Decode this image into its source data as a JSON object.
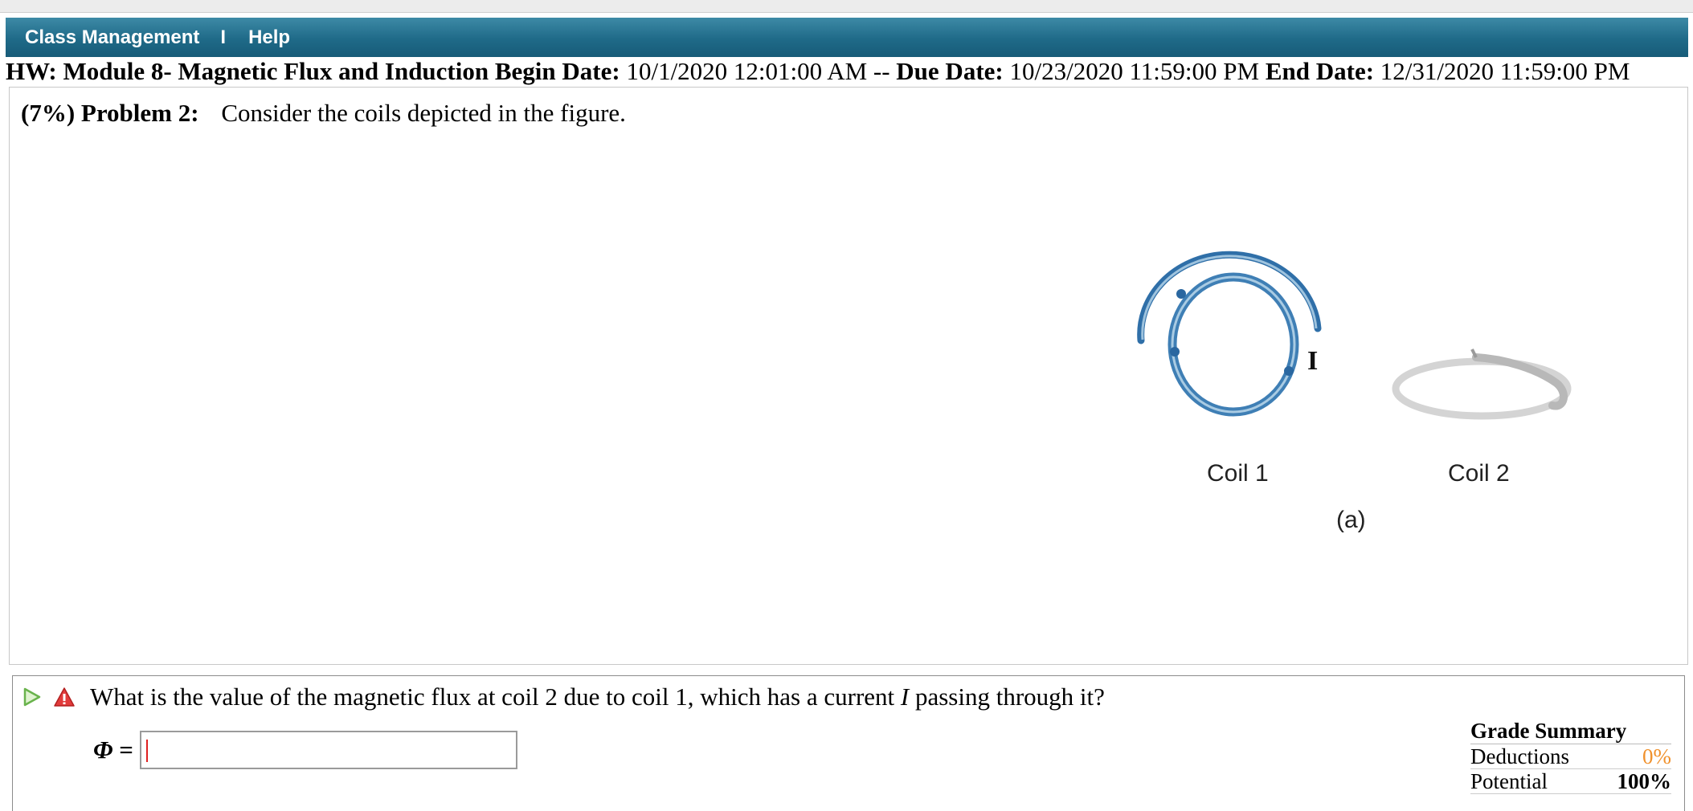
{
  "nav": {
    "class_management": "Class Management",
    "separator": "I",
    "help": "Help"
  },
  "hw_header": {
    "title": "HW: Module 8- Magnetic Flux and Induction",
    "begin_label": "Begin Date:",
    "begin_value": "10/1/2020 12:01:00 AM --",
    "due_label": "Due Date:",
    "due_value": "10/23/2020 11:59:00 PM",
    "end_label": "End Date:",
    "end_value": "12/31/2020 11:59:00 PM"
  },
  "problem": {
    "weight": "(7%)",
    "label": "Problem 2:",
    "statement": "Consider the coils depicted in the figure."
  },
  "figure": {
    "current_label": "I",
    "coil1_label": "Coil 1",
    "coil2_label": "Coil 2",
    "caption": "(a)"
  },
  "question": {
    "text_before": "What is the value of the magnetic flux at coil 2 due to coil 1, which has a current ",
    "text_italic": "I",
    "text_after": " passing through it?",
    "answer_symbol": "Φ",
    "answer_equals": "=",
    "answer_value": ""
  },
  "grade_summary": {
    "title": "Grade Summary",
    "deductions_label": "Deductions",
    "deductions_value": "0%",
    "potential_label": "Potential",
    "potential_value": "100%"
  },
  "colors": {
    "navbar": "#1f6a88",
    "deductions": "#f0912c",
    "coil1": "#3f7fb5",
    "coil2": "#d9d9d9"
  }
}
